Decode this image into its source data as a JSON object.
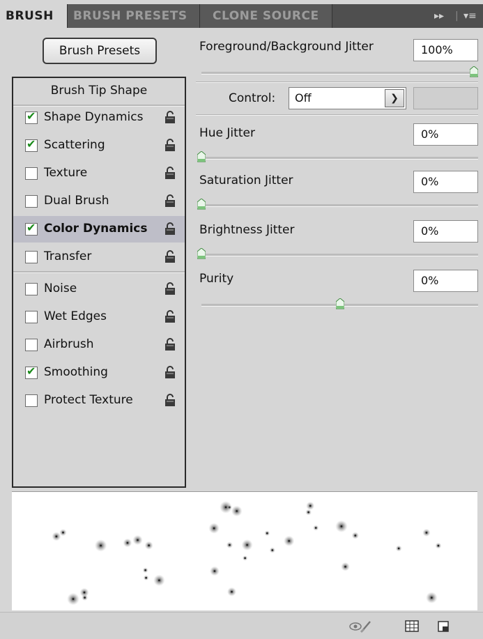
{
  "tabs": [
    {
      "label": "BRUSH",
      "active": true
    },
    {
      "label": "BRUSH PRESETS",
      "active": false
    },
    {
      "label": "CLONE SOURCE",
      "active": false
    }
  ],
  "tabbar_icons": [
    "expand-arrows-icon",
    "panel-menu-icon"
  ],
  "left": {
    "presets_button": "Brush Presets",
    "tip_shape_header": "Brush Tip Shape",
    "options": [
      {
        "label": "Shape Dynamics",
        "checked": true,
        "selected": false
      },
      {
        "label": "Scattering",
        "checked": true,
        "selected": false
      },
      {
        "label": "Texture",
        "checked": false,
        "selected": false
      },
      {
        "label": "Dual Brush",
        "checked": false,
        "selected": false
      },
      {
        "label": "Color Dynamics",
        "checked": true,
        "selected": true
      },
      {
        "label": "Transfer",
        "checked": false,
        "selected": false
      },
      {
        "label": "Noise",
        "checked": false,
        "selected": false
      },
      {
        "label": "Wet Edges",
        "checked": false,
        "selected": false
      },
      {
        "label": "Airbrush",
        "checked": false,
        "selected": false
      },
      {
        "label": "Smoothing",
        "checked": true,
        "selected": false
      },
      {
        "label": "Protect Texture",
        "checked": false,
        "selected": false
      }
    ]
  },
  "right": {
    "fg_bg_jitter": {
      "label": "Foreground/Background Jitter",
      "value": "100%",
      "slider_fraction": 1.0
    },
    "control": {
      "label": "Control:",
      "value": "Off"
    },
    "hue_jitter": {
      "label": "Hue Jitter",
      "value": "0%",
      "slider_fraction": 0.0
    },
    "saturation_jitter": {
      "label": "Saturation Jitter",
      "value": "0%",
      "slider_fraction": 0.0
    },
    "brightness_jitter": {
      "label": "Brightness Jitter",
      "value": "0%",
      "slider_fraction": 0.0
    },
    "purity": {
      "label": "Purity",
      "value": "0%",
      "slider_fraction": 0.5
    }
  },
  "bottom_icons": [
    "eye-brush-icon",
    "grid-icon",
    "new-preset-icon"
  ],
  "colors": {
    "tab_bar": "#4f4f4f",
    "panel_bg": "#d6d6d6",
    "selected_row": "#bebec8",
    "checkmark": "#1a8a1a",
    "slider_thumb": "#7cc47c"
  }
}
